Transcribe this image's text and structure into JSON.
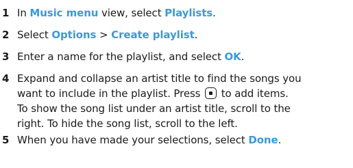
{
  "steps": [
    {
      "number": "1",
      "text_before": "In ",
      "link1": "Music menu",
      "text_middle": " view, select ",
      "link2": "Playlists",
      "text_after": "."
    },
    {
      "number": "2",
      "text_before": "Select ",
      "link1": "Options",
      "text_middle": " > ",
      "link2": "Create playlist",
      "text_after": "."
    },
    {
      "number": "3",
      "text_before": "Enter a name for the playlist, and select ",
      "link1": "OK",
      "text_after": "."
    },
    {
      "number": "4",
      "line1": "Expand and collapse an artist title to find the songs you",
      "line2_before": "want to include in the playlist. Press ",
      "key_icon": "navi-key-icon",
      "line2_after": " to add items.",
      "line3": "To show the song list under an artist title, scroll to the",
      "line4": "right. To hide the song list, scroll to the left."
    },
    {
      "number": "5",
      "text_before": "When you have made your selections, select ",
      "link1": "Done",
      "text_after": "."
    }
  ],
  "colors": {
    "highlight": "#3a9ad9",
    "text": "#1a1a1a"
  }
}
